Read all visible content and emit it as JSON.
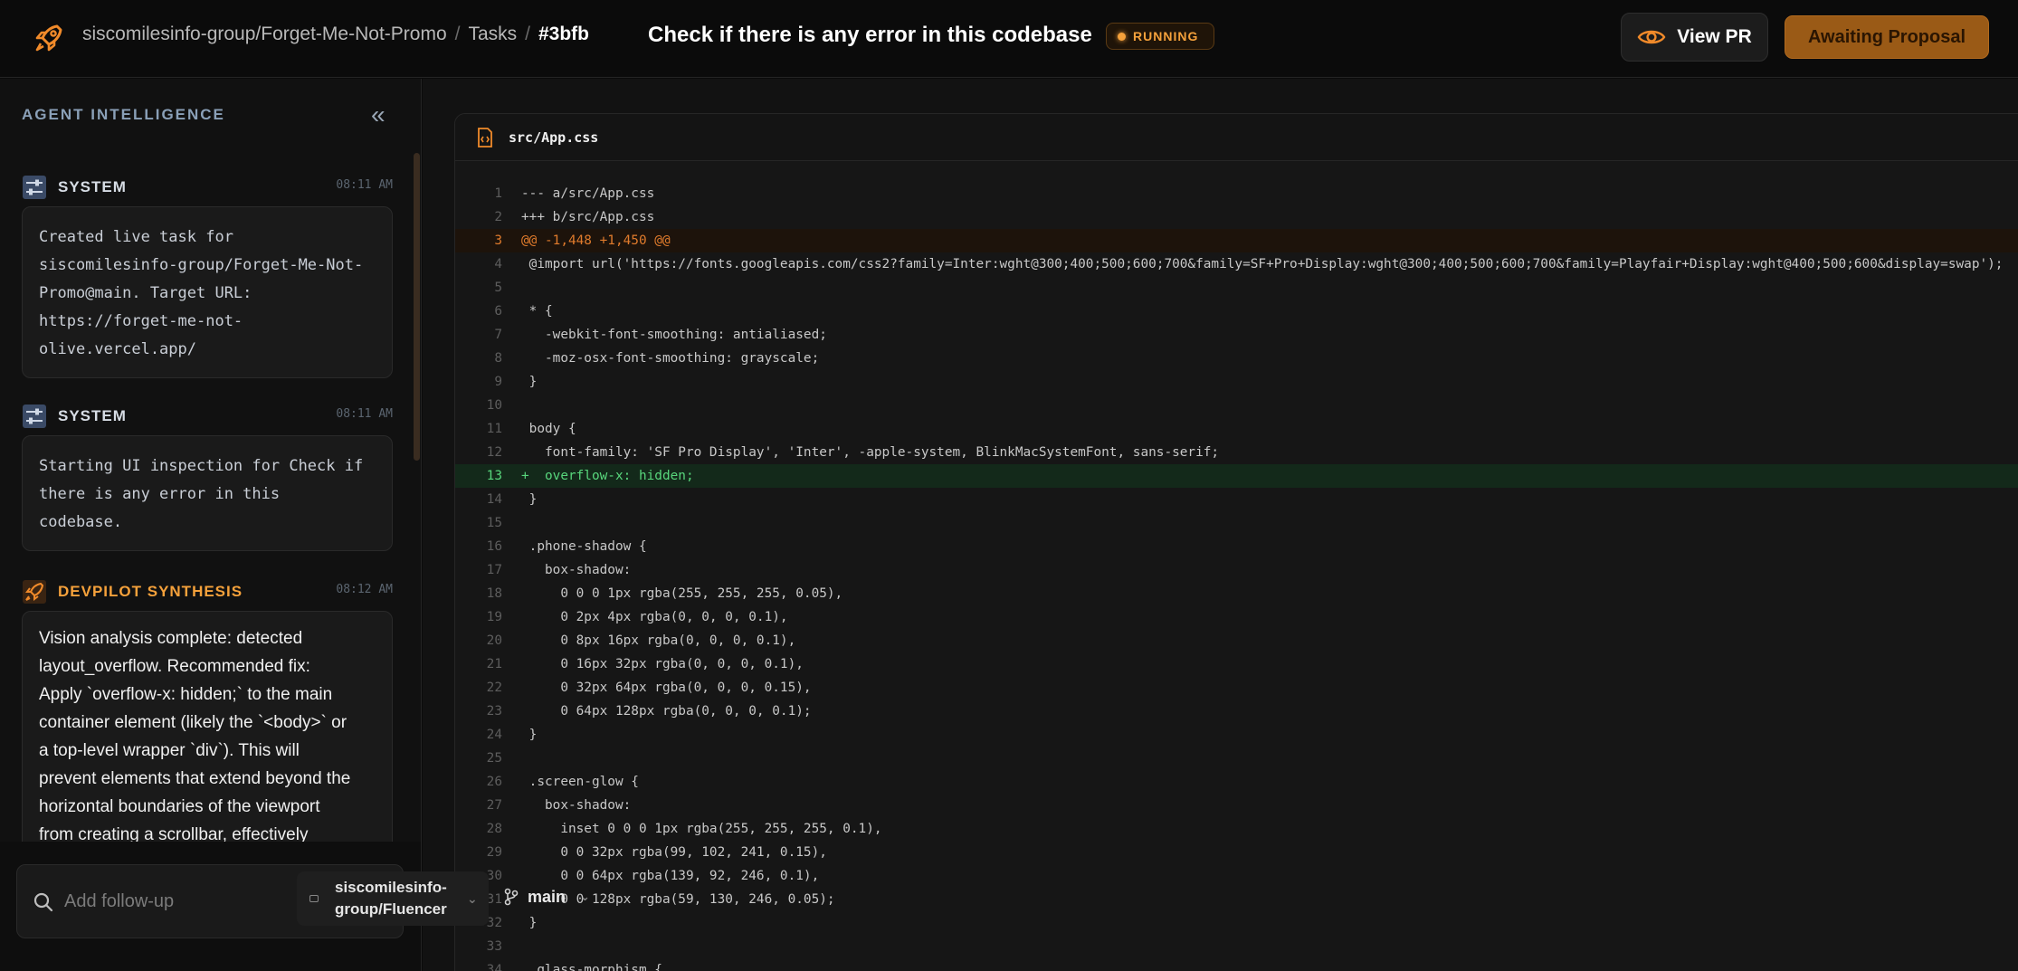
{
  "header": {
    "breadcrumb": {
      "repo": "siscomilesinfo-group/Forget-Me-Not-Promo",
      "section": "Tasks",
      "task_id": "#3bfb"
    },
    "title": "Check if there is any error in this codebase",
    "status": "RUNNING",
    "view_pr_label": "View PR",
    "awaiting_label": "Awaiting Proposal"
  },
  "sidebar": {
    "heading": "AGENT INTELLIGENCE",
    "messages": [
      {
        "author": "SYSTEM",
        "time": "08:11 AM",
        "lines": [
          "Created live task for",
          "siscomilesinfo-group/Forget-Me-Not-",
          "Promo@main. Target URL:",
          "https://forget-me-not-",
          "olive.vercel.app/"
        ]
      },
      {
        "author": "SYSTEM",
        "time": "08:11 AM",
        "lines": [
          "Starting UI inspection for Check if",
          "there is any error in this",
          "codebase."
        ]
      },
      {
        "author": "DEVPILOT SYNTHESIS",
        "time": "08:12 AM",
        "lines": [
          "Vision analysis complete: detected",
          "layout_overflow. Recommended fix:",
          "Apply `overflow-x: hidden;` to the main",
          "container element (likely the `<body>` or",
          "a top-level wrapper `div`). This will",
          "prevent elements that extend beyond the",
          "horizontal boundaries of the viewport",
          "from creating a scrollbar, effectively"
        ]
      }
    ],
    "composer": {
      "placeholder": "Add follow-up",
      "repo_line1": "siscomilesinfo-",
      "repo_line2": "group/Fluencer",
      "branch": "main"
    }
  },
  "code": {
    "filename": "src/App.css",
    "lines": [
      {
        "n": "1",
        "t": "--- a/src/App.css",
        "k": ""
      },
      {
        "n": "2",
        "t": "+++ b/src/App.css",
        "k": ""
      },
      {
        "n": "3",
        "t": "@@ -1,448 +1,450 @@",
        "k": "hunk"
      },
      {
        "n": "4",
        "t": " @import url('https://fonts.googleapis.com/css2?family=Inter:wght@300;400;500;600;700&family=SF+Pro+Display:wght@300;400;500;600;700&family=Playfair+Display:wght@400;500;600&display=swap');",
        "k": ""
      },
      {
        "n": "5",
        "t": "",
        "k": ""
      },
      {
        "n": "6",
        "t": " * {",
        "k": ""
      },
      {
        "n": "7",
        "t": "   -webkit-font-smoothing: antialiased;",
        "k": ""
      },
      {
        "n": "8",
        "t": "   -moz-osx-font-smoothing: grayscale;",
        "k": ""
      },
      {
        "n": "9",
        "t": " }",
        "k": ""
      },
      {
        "n": "10",
        "t": "",
        "k": ""
      },
      {
        "n": "11",
        "t": " body {",
        "k": ""
      },
      {
        "n": "12",
        "t": "   font-family: 'SF Pro Display', 'Inter', -apple-system, BlinkMacSystemFont, sans-serif;",
        "k": ""
      },
      {
        "n": "13",
        "t": "+  overflow-x: hidden;",
        "k": "add"
      },
      {
        "n": "14",
        "t": " }",
        "k": ""
      },
      {
        "n": "15",
        "t": "",
        "k": ""
      },
      {
        "n": "16",
        "t": " .phone-shadow {",
        "k": ""
      },
      {
        "n": "17",
        "t": "   box-shadow:",
        "k": ""
      },
      {
        "n": "18",
        "t": "     0 0 0 1px rgba(255, 255, 255, 0.05),",
        "k": ""
      },
      {
        "n": "19",
        "t": "     0 2px 4px rgba(0, 0, 0, 0.1),",
        "k": ""
      },
      {
        "n": "20",
        "t": "     0 8px 16px rgba(0, 0, 0, 0.1),",
        "k": ""
      },
      {
        "n": "21",
        "t": "     0 16px 32px rgba(0, 0, 0, 0.1),",
        "k": ""
      },
      {
        "n": "22",
        "t": "     0 32px 64px rgba(0, 0, 0, 0.15),",
        "k": ""
      },
      {
        "n": "23",
        "t": "     0 64px 128px rgba(0, 0, 0, 0.1);",
        "k": ""
      },
      {
        "n": "24",
        "t": " }",
        "k": ""
      },
      {
        "n": "25",
        "t": "",
        "k": ""
      },
      {
        "n": "26",
        "t": " .screen-glow {",
        "k": ""
      },
      {
        "n": "27",
        "t": "   box-shadow:",
        "k": ""
      },
      {
        "n": "28",
        "t": "     inset 0 0 0 1px rgba(255, 255, 255, 0.1),",
        "k": ""
      },
      {
        "n": "29",
        "t": "     0 0 32px rgba(99, 102, 241, 0.15),",
        "k": ""
      },
      {
        "n": "30",
        "t": "     0 0 64px rgba(139, 92, 246, 0.1),",
        "k": ""
      },
      {
        "n": "31",
        "t": "     0 0 128px rgba(59, 130, 246, 0.05);",
        "k": ""
      },
      {
        "n": "32",
        "t": " }",
        "k": ""
      },
      {
        "n": "33",
        "t": "",
        "k": ""
      },
      {
        "n": "34",
        "t": " .glass-morphism {",
        "k": ""
      }
    ]
  }
}
